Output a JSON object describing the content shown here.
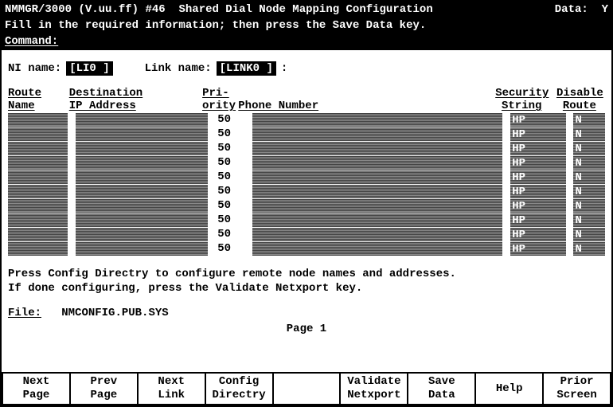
{
  "header": {
    "app": "NMMGR/3000",
    "version": "(V.uu.ff)",
    "screen_id": "#46",
    "title": "Shared Dial Node Mapping Configuration",
    "data_label": "Data:",
    "data_value": "Y"
  },
  "instruction": "Fill in the required information; then press the Save Data key.",
  "command_label": "Command:",
  "fields": {
    "ni_label": "NI name:",
    "ni_value": "[LI0     ]",
    "link_label": "Link name:",
    "link_value": "[LINK0   ]",
    "link_suffix": ":"
  },
  "columns": {
    "route1": "Route",
    "route2": "Name",
    "dest1": "Destination",
    "dest2": "IP Address",
    "pri1": "Pri-",
    "pri2": "ority",
    "phone1": "",
    "phone2": "Phone Number",
    "sec1": "Security",
    "sec2": "String",
    "dis1": "Disable",
    "dis2": "Route"
  },
  "rows": [
    {
      "route": "",
      "dest": "",
      "pri": "50",
      "phone": "",
      "sec": "HP",
      "dis": "N"
    },
    {
      "route": "",
      "dest": "",
      "pri": "50",
      "phone": "",
      "sec": "HP",
      "dis": "N"
    },
    {
      "route": "",
      "dest": "",
      "pri": "50",
      "phone": "",
      "sec": "HP",
      "dis": "N"
    },
    {
      "route": "",
      "dest": "",
      "pri": "50",
      "phone": "",
      "sec": "HP",
      "dis": "N"
    },
    {
      "route": "",
      "dest": "",
      "pri": "50",
      "phone": "",
      "sec": "HP",
      "dis": "N"
    },
    {
      "route": "",
      "dest": "",
      "pri": "50",
      "phone": "",
      "sec": "HP",
      "dis": "N"
    },
    {
      "route": "",
      "dest": "",
      "pri": "50",
      "phone": "",
      "sec": "HP",
      "dis": "N"
    },
    {
      "route": "",
      "dest": "",
      "pri": "50",
      "phone": "",
      "sec": "HP",
      "dis": "N"
    },
    {
      "route": "",
      "dest": "",
      "pri": "50",
      "phone": "",
      "sec": "HP",
      "dis": "N"
    },
    {
      "route": "",
      "dest": "",
      "pri": "50",
      "phone": "",
      "sec": "HP",
      "dis": "N"
    }
  ],
  "help": {
    "line1": "Press Config Directry to configure remote node names and addresses.",
    "line2": "If done configuring, press the Validate Netxport key."
  },
  "file": {
    "label": "File:",
    "value": "NMCONFIG.PUB.SYS"
  },
  "page": "Page 1",
  "fkeys": [
    {
      "l1": "Next",
      "l2": "Page"
    },
    {
      "l1": "Prev",
      "l2": "Page"
    },
    {
      "l1": "Next",
      "l2": "Link"
    },
    {
      "l1": "Config",
      "l2": "Directry"
    },
    {
      "l1": "",
      "l2": ""
    },
    {
      "l1": "Validate",
      "l2": "Netxport"
    },
    {
      "l1": "Save",
      "l2": "Data"
    },
    {
      "l1": "Help",
      "l2": ""
    },
    {
      "l1": "Prior",
      "l2": "Screen"
    }
  ]
}
